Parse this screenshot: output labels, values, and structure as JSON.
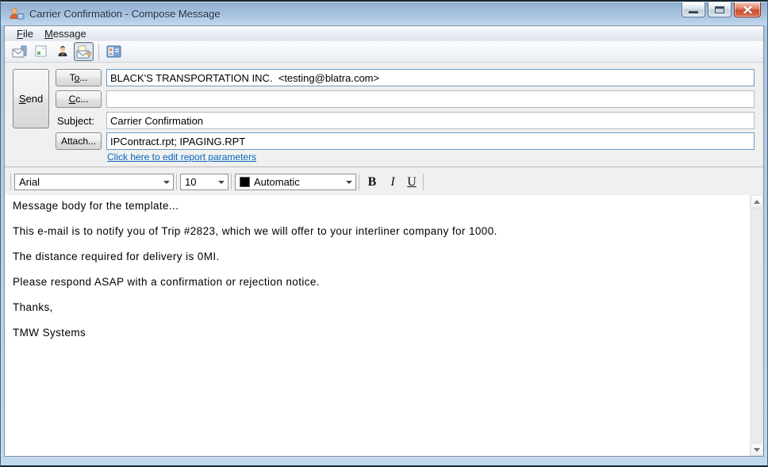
{
  "window": {
    "title": "Carrier Confirmation - Compose Message"
  },
  "menu": {
    "file": {
      "accel": "F",
      "rest": "ile"
    },
    "message": {
      "accel": "M",
      "rest": "essage"
    }
  },
  "toolbar": {
    "icons": [
      "mail-icon",
      "stationery-icon",
      "contact-icon",
      "compose-message-icon",
      "address-book-icon"
    ],
    "active_icon": "compose-message-icon"
  },
  "compose": {
    "send_button": {
      "accel": "S",
      "rest": "end"
    },
    "to_button": {
      "pre": "T",
      "accel": "o",
      "rest": "..."
    },
    "cc_button": {
      "accel": "C",
      "rest": "c..."
    },
    "subject_label": "Subject:",
    "attach_button_label": "Attach...",
    "to_value": "BLACK'S TRANSPORTATION INC.  <testing@blatra.com>",
    "cc_value": "",
    "subject_value": "Carrier Confirmation",
    "attach_value": "IPContract.rpt; IPAGING.RPT",
    "report_link": "Click here to edit report parameters"
  },
  "format_toolbar": {
    "font_family": "Arial",
    "font_size": "10",
    "font_color_label": "Automatic",
    "font_color_hex": "#000000",
    "bold_label": "B",
    "italic_label": "I",
    "underline_label": "U"
  },
  "body": {
    "lines": [
      "Message body for the template...",
      "This e-mail is to notify you of Trip #2823, which we will offer to your interliner company for 1000.",
      "The distance required for delivery is 0MI.",
      "Please respond ASAP with a confirmation or rejection notice.",
      "Thanks,",
      "TMW Systems"
    ]
  },
  "colors": {
    "titlebar_top": "#8fafd0",
    "titlebar_bottom": "#c0d9ef",
    "link_blue": "#0563c1",
    "close_red": "#cc4f33",
    "header_gray": "#f0f0f0"
  }
}
